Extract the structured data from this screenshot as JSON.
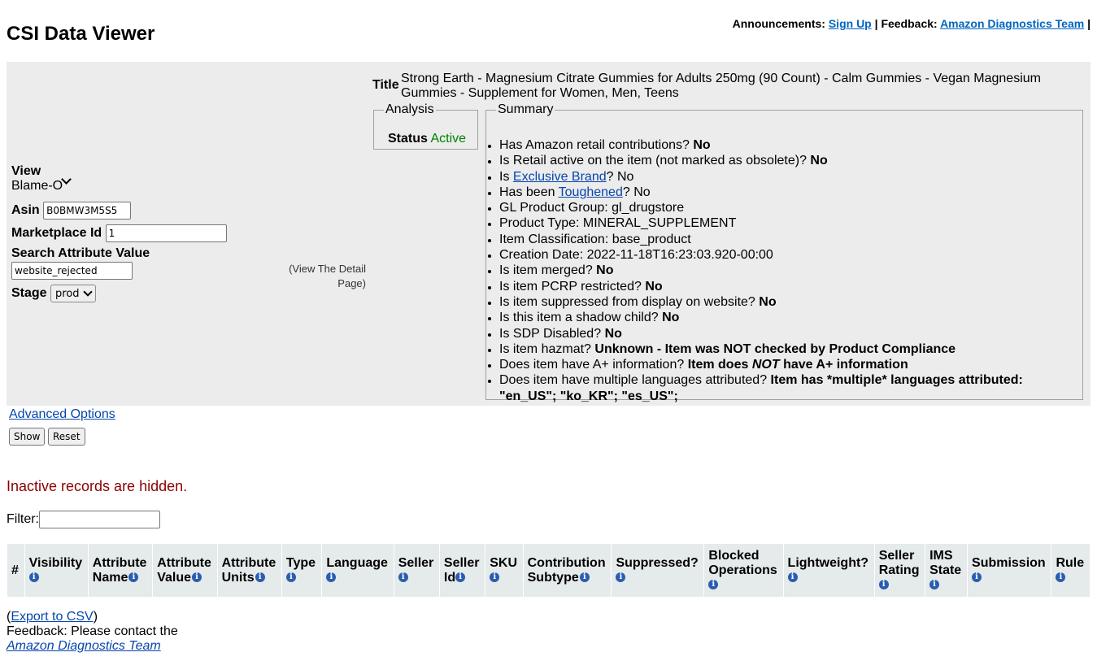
{
  "header": {
    "title": "CSI Data Viewer",
    "announcements_label": "Announcements:",
    "signup_link": "Sign Up",
    "separator": "|",
    "feedback_label": "Feedback:",
    "feedback_link": "Amazon Diagnostics Team",
    "trailing_separator": "|"
  },
  "form": {
    "view_label": "View",
    "view_value": "Blame-O",
    "asin_label": "Asin",
    "asin_value": "B0BMW3M5S5",
    "marketplace_label": "Marketplace Id",
    "marketplace_value": "1",
    "search_label": "Search Attribute Value",
    "search_value": "website_rejected",
    "stage_label": "Stage",
    "stage_value": "prod",
    "view_detail_line1": "(View The Detail",
    "view_detail_line2": "Page)"
  },
  "item": {
    "title_label": "Title",
    "title": "Strong Earth - Magnesium Citrate Gummies for Adults 250mg (90 Count) - Calm Gummies - Vegan Magnesium Gummies - Supplement for Women, Men, Teens"
  },
  "analysis": {
    "legend": "Analysis",
    "status_label": "Status",
    "status_value": "Active",
    "status_color": "#008000"
  },
  "summary": {
    "legend": "Summary",
    "q_retail_contrib": "Has Amazon retail contributions?",
    "a_retail_contrib": "No",
    "q_retail_active": "Is Retail active on the item (not marked as obsolete)?",
    "a_retail_active": "No",
    "q_exclusive_pre": "Is",
    "q_exclusive_link": "Exclusive Brand",
    "q_exclusive_post": "? No",
    "q_toughened_pre": "Has been",
    "q_toughened_link": "Toughened",
    "q_toughened_post": "? No",
    "gl_group": "GL Product Group: gl_drugstore",
    "product_type": "Product Type: MINERAL_SUPPLEMENT",
    "classification": "Item Classification: base_product",
    "creation_date": "Creation Date: 2022-11-18T16:23:03.920-00:00",
    "q_merged": "Is item merged?",
    "a_merged": "No",
    "q_pcrp": "Is item PCRP restricted?",
    "a_pcrp": "No",
    "q_suppressed": "Is item suppressed from display on website?",
    "a_suppressed": "No",
    "q_shadow": "Is this item a shadow child?",
    "a_shadow": "No",
    "q_sdp": "Is SDP Disabled?",
    "a_sdp": "No",
    "q_hazmat": "Is item hazmat?",
    "a_hazmat": "Unknown - Item was NOT checked by Product Compliance",
    "q_aplus": "Does item have A+ information?",
    "a_aplus_pre": "Item does",
    "a_aplus_em": "NOT",
    "a_aplus_post": "have A+ information",
    "q_languages": "Does item have multiple languages attributed?",
    "a_languages": "Item has *multiple* languages attributed: \"en_US\"; \"ko_KR\"; \"es_US\";"
  },
  "controls": {
    "advanced_options": "Advanced Options",
    "show_button": "Show",
    "reset_button": "Reset",
    "inactive_notice": "Inactive records are hidden.",
    "filter_label": "Filter:",
    "filter_value": ""
  },
  "table": {
    "columns": [
      {
        "line1": "#",
        "line2": ""
      },
      {
        "line1": "Visibility",
        "line2": ""
      },
      {
        "line1": "Attribute",
        "line2": "Name"
      },
      {
        "line1": "Attribute",
        "line2": "Value"
      },
      {
        "line1": "Attribute",
        "line2": "Units"
      },
      {
        "line1": "Type",
        "line2": ""
      },
      {
        "line1": "Language",
        "line2": ""
      },
      {
        "line1": "Seller",
        "line2": ""
      },
      {
        "line1": "Seller",
        "line2": "Id"
      },
      {
        "line1": "SKU",
        "line2": ""
      },
      {
        "line1": "Contribution",
        "line2": "Subtype"
      },
      {
        "line1": "Suppressed?",
        "line2": ""
      },
      {
        "line1": "Blocked",
        "line2": "Operations"
      },
      {
        "line1": "Lightweight?",
        "line2": ""
      },
      {
        "line1": "Seller",
        "line2": "Rating"
      },
      {
        "line1": "IMS",
        "line2": "State"
      },
      {
        "line1": "Submission",
        "line2": ""
      },
      {
        "line1": "Rule",
        "line2": ""
      }
    ],
    "info_glyph": "i"
  },
  "footer": {
    "export_open": "(",
    "export_link": "Export to CSV",
    "export_close": ")",
    "feedback_text": "Feedback: Please contact the",
    "feedback_link": "Amazon Diagnostics Team"
  }
}
